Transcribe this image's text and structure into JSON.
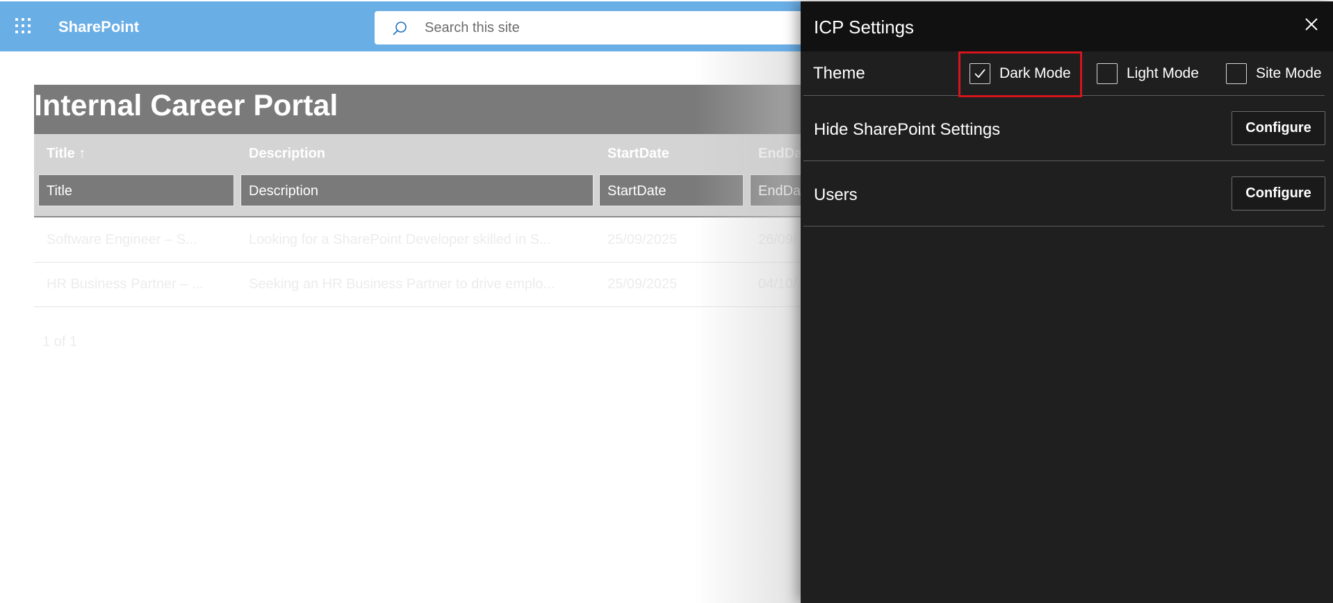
{
  "suite_bar": {
    "app_name": "SharePoint",
    "search_placeholder": "Search this site",
    "color": "#6aaee6"
  },
  "page": {
    "title": "Internal Career Portal",
    "columns": [
      {
        "header": "Title ↑",
        "filter_placeholder": "Title"
      },
      {
        "header": "Description",
        "filter_placeholder": "Description"
      },
      {
        "header": "StartDate",
        "filter_placeholder": "StartDate"
      },
      {
        "header": "EndDate",
        "filter_placeholder": "EndDate"
      }
    ],
    "rows": [
      {
        "title": "Software Engineer – S...",
        "description": "Looking for a SharePoint Developer skilled in S...",
        "start_date": "25/09/2025",
        "end_date": "26/09/"
      },
      {
        "title": "HR Business Partner – ...",
        "description": "Seeking an HR Business Partner to drive emplo...",
        "start_date": "25/09/2025",
        "end_date": "04/10/"
      }
    ],
    "pager": "1 of 1"
  },
  "panel": {
    "title": "ICP Settings",
    "close_icon": "close-icon",
    "theme": {
      "label": "Theme",
      "options": [
        {
          "label": "Dark Mode",
          "checked": true
        },
        {
          "label": "Light Mode",
          "checked": false
        },
        {
          "label": "Site Mode",
          "checked": false
        }
      ],
      "highlight_color": "#d6151c"
    },
    "hide_settings": {
      "label": "Hide SharePoint Settings",
      "button_label": "Configure"
    },
    "users": {
      "label": "Users",
      "button_label": "Configure"
    }
  }
}
